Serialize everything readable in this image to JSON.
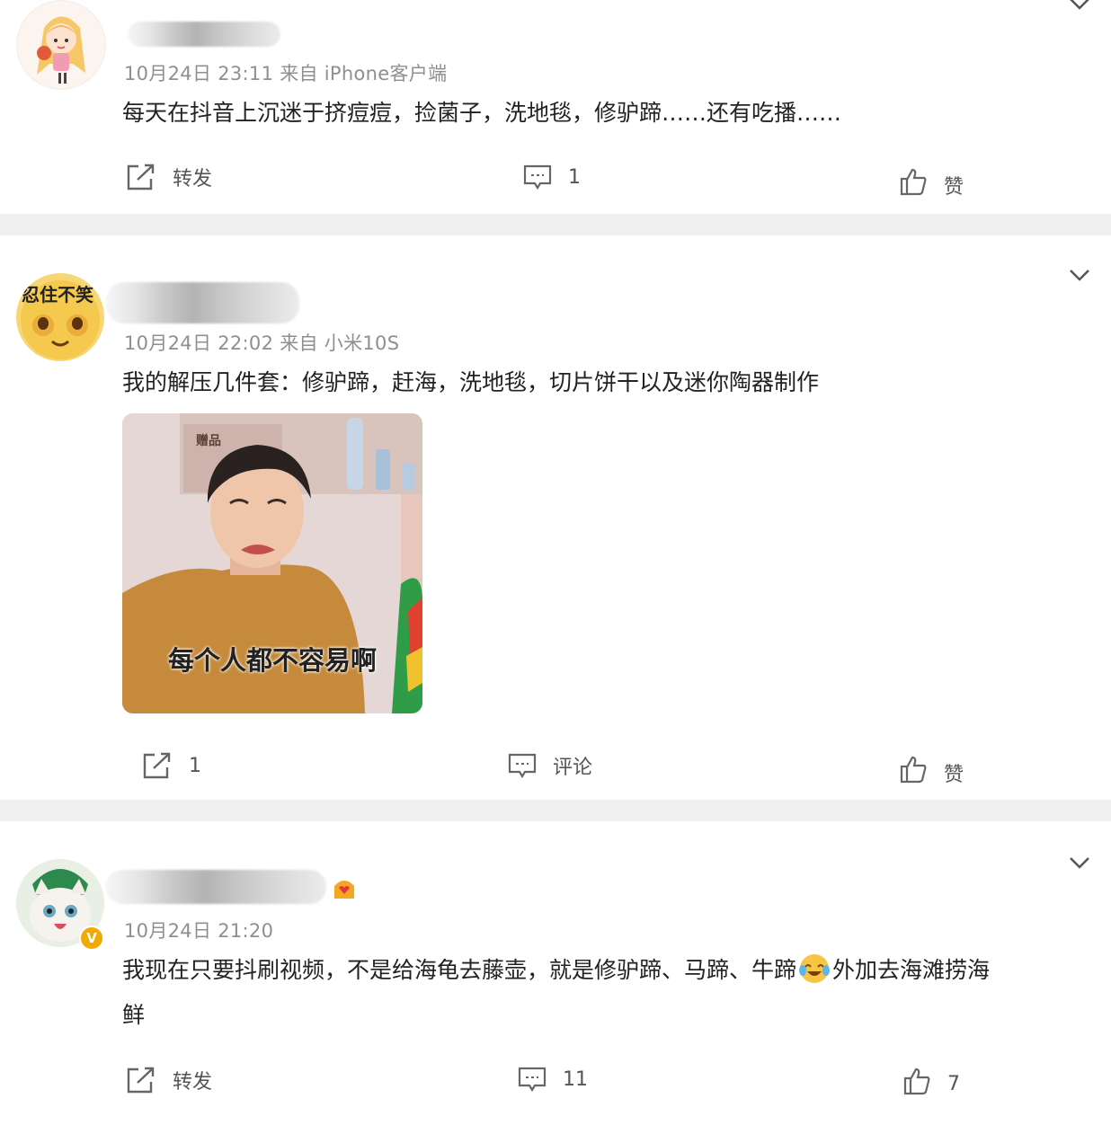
{
  "comments": [
    {
      "meta": "10月24日 23:11  来自 iPhone客户端",
      "text": "每天在抖音上沉迷于挤痘痘，捡菌子，洗地毯，修驴蹄……还有吃播……",
      "actions": {
        "repost": "转发",
        "comment": "1",
        "like": "赞"
      }
    },
    {
      "meta": "10月24日 22:02  来自 小米10S",
      "avatar_text": "忍住不笑",
      "text": "我的解压几件套：修驴蹄，赶海，洗地毯，切片饼干以及迷你陶器制作",
      "sticker_caption": "每个人都不容易啊",
      "sticker_sign": "赠品",
      "actions": {
        "repost": "1",
        "comment": "评论",
        "like": "赞"
      }
    },
    {
      "meta": "10月24日 21:20",
      "text_line1": "我现在只要抖刷视频，不是给海龟去藤壶，就是修驴蹄、马蹄、牛蹄",
      "text_line1_after": "外加去海滩捞海",
      "text_line2": "鲜",
      "verified_badge": "V",
      "actions": {
        "repost": "转发",
        "comment": "11",
        "like": "7"
      }
    }
  ]
}
